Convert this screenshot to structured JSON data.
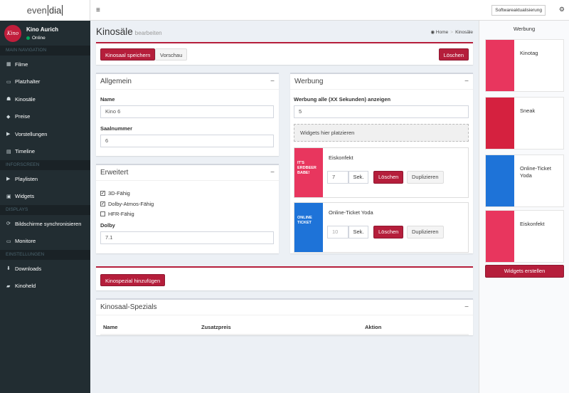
{
  "app": {
    "logo_prefix": "even",
    "logo_mid": "dia"
  },
  "user": {
    "avatar_text": "Kino",
    "name": "Kino Aurich",
    "status": "Online"
  },
  "nav": {
    "sections": [
      "MAIN NAVIGATION",
      "Inforscreen",
      "DISPLAYS",
      "EINSTELLUNGEN"
    ],
    "items": [
      "Filme",
      "Platzhalter",
      "Kinosäle",
      "Preise",
      "Vorstellungen",
      "Timeline",
      "Playlisten",
      "Widgets",
      "Bildschirme synchronisieren",
      "Monitore",
      "Downloads",
      "Kinoheld"
    ]
  },
  "topbar": {
    "menu_icon": "≡",
    "update_label": "Softwareaktualisierung",
    "settings_icon": "⚙"
  },
  "page": {
    "title": "Kinosäle",
    "subtitle": "bearbeiten",
    "breadcrumb_home": "Home",
    "breadcrumb_current": "Kinosäle"
  },
  "toolbar": {
    "save": "Kinosaal speichern",
    "preview": "Vorschau",
    "delete": "Löschen"
  },
  "allgemein": {
    "title": "Allgemein",
    "name_label": "Name",
    "name_value": "Kino 6",
    "number_label": "Saalnummer",
    "number_value": "6"
  },
  "erweitert": {
    "title": "Erweitert",
    "checks": [
      {
        "label": "3D-Fähig",
        "checked": true
      },
      {
        "label": "Dolby-Atmos-Fähig",
        "checked": true
      },
      {
        "label": "HFR-Fähig",
        "checked": false
      }
    ],
    "dolby_label": "Dolby",
    "dolby_value": "7.1"
  },
  "werbung": {
    "title": "Werbung",
    "interval_label": "Werbung alle (XX Sekunden) anzeigen",
    "interval_value": "5",
    "dropzone": "Widgets hier platzieren",
    "widgets": [
      {
        "name": "Eiskonfekt",
        "seconds": "7",
        "placeholder": "",
        "unit": "Sek.",
        "delete": "Löschen",
        "duplicate": "Duplizieren",
        "thumb_text": "IT'S ERDBEER BABE!"
      },
      {
        "name": "Online-Ticket Yoda",
        "seconds": "",
        "placeholder": "10",
        "unit": "Sek.",
        "delete": "Löschen",
        "duplicate": "Duplizieren",
        "thumb_text": "ONLINE TICKET"
      }
    ]
  },
  "spezial": {
    "add_button": "Kinospezial hinzufügen",
    "title": "Kinosaal-Spezials",
    "columns": [
      "Name",
      "Zusatzpreis",
      "Aktion"
    ]
  },
  "right_panel": {
    "title": "Werbung",
    "items": [
      "Kinotag",
      "Sneak",
      "Online-Ticket Yoda",
      "Eiskonfekt"
    ],
    "create_button": "Widgets erstellen"
  },
  "colors": {
    "accent": "#b51e3b",
    "sidebar": "#222d32",
    "online": "#00a65a"
  }
}
